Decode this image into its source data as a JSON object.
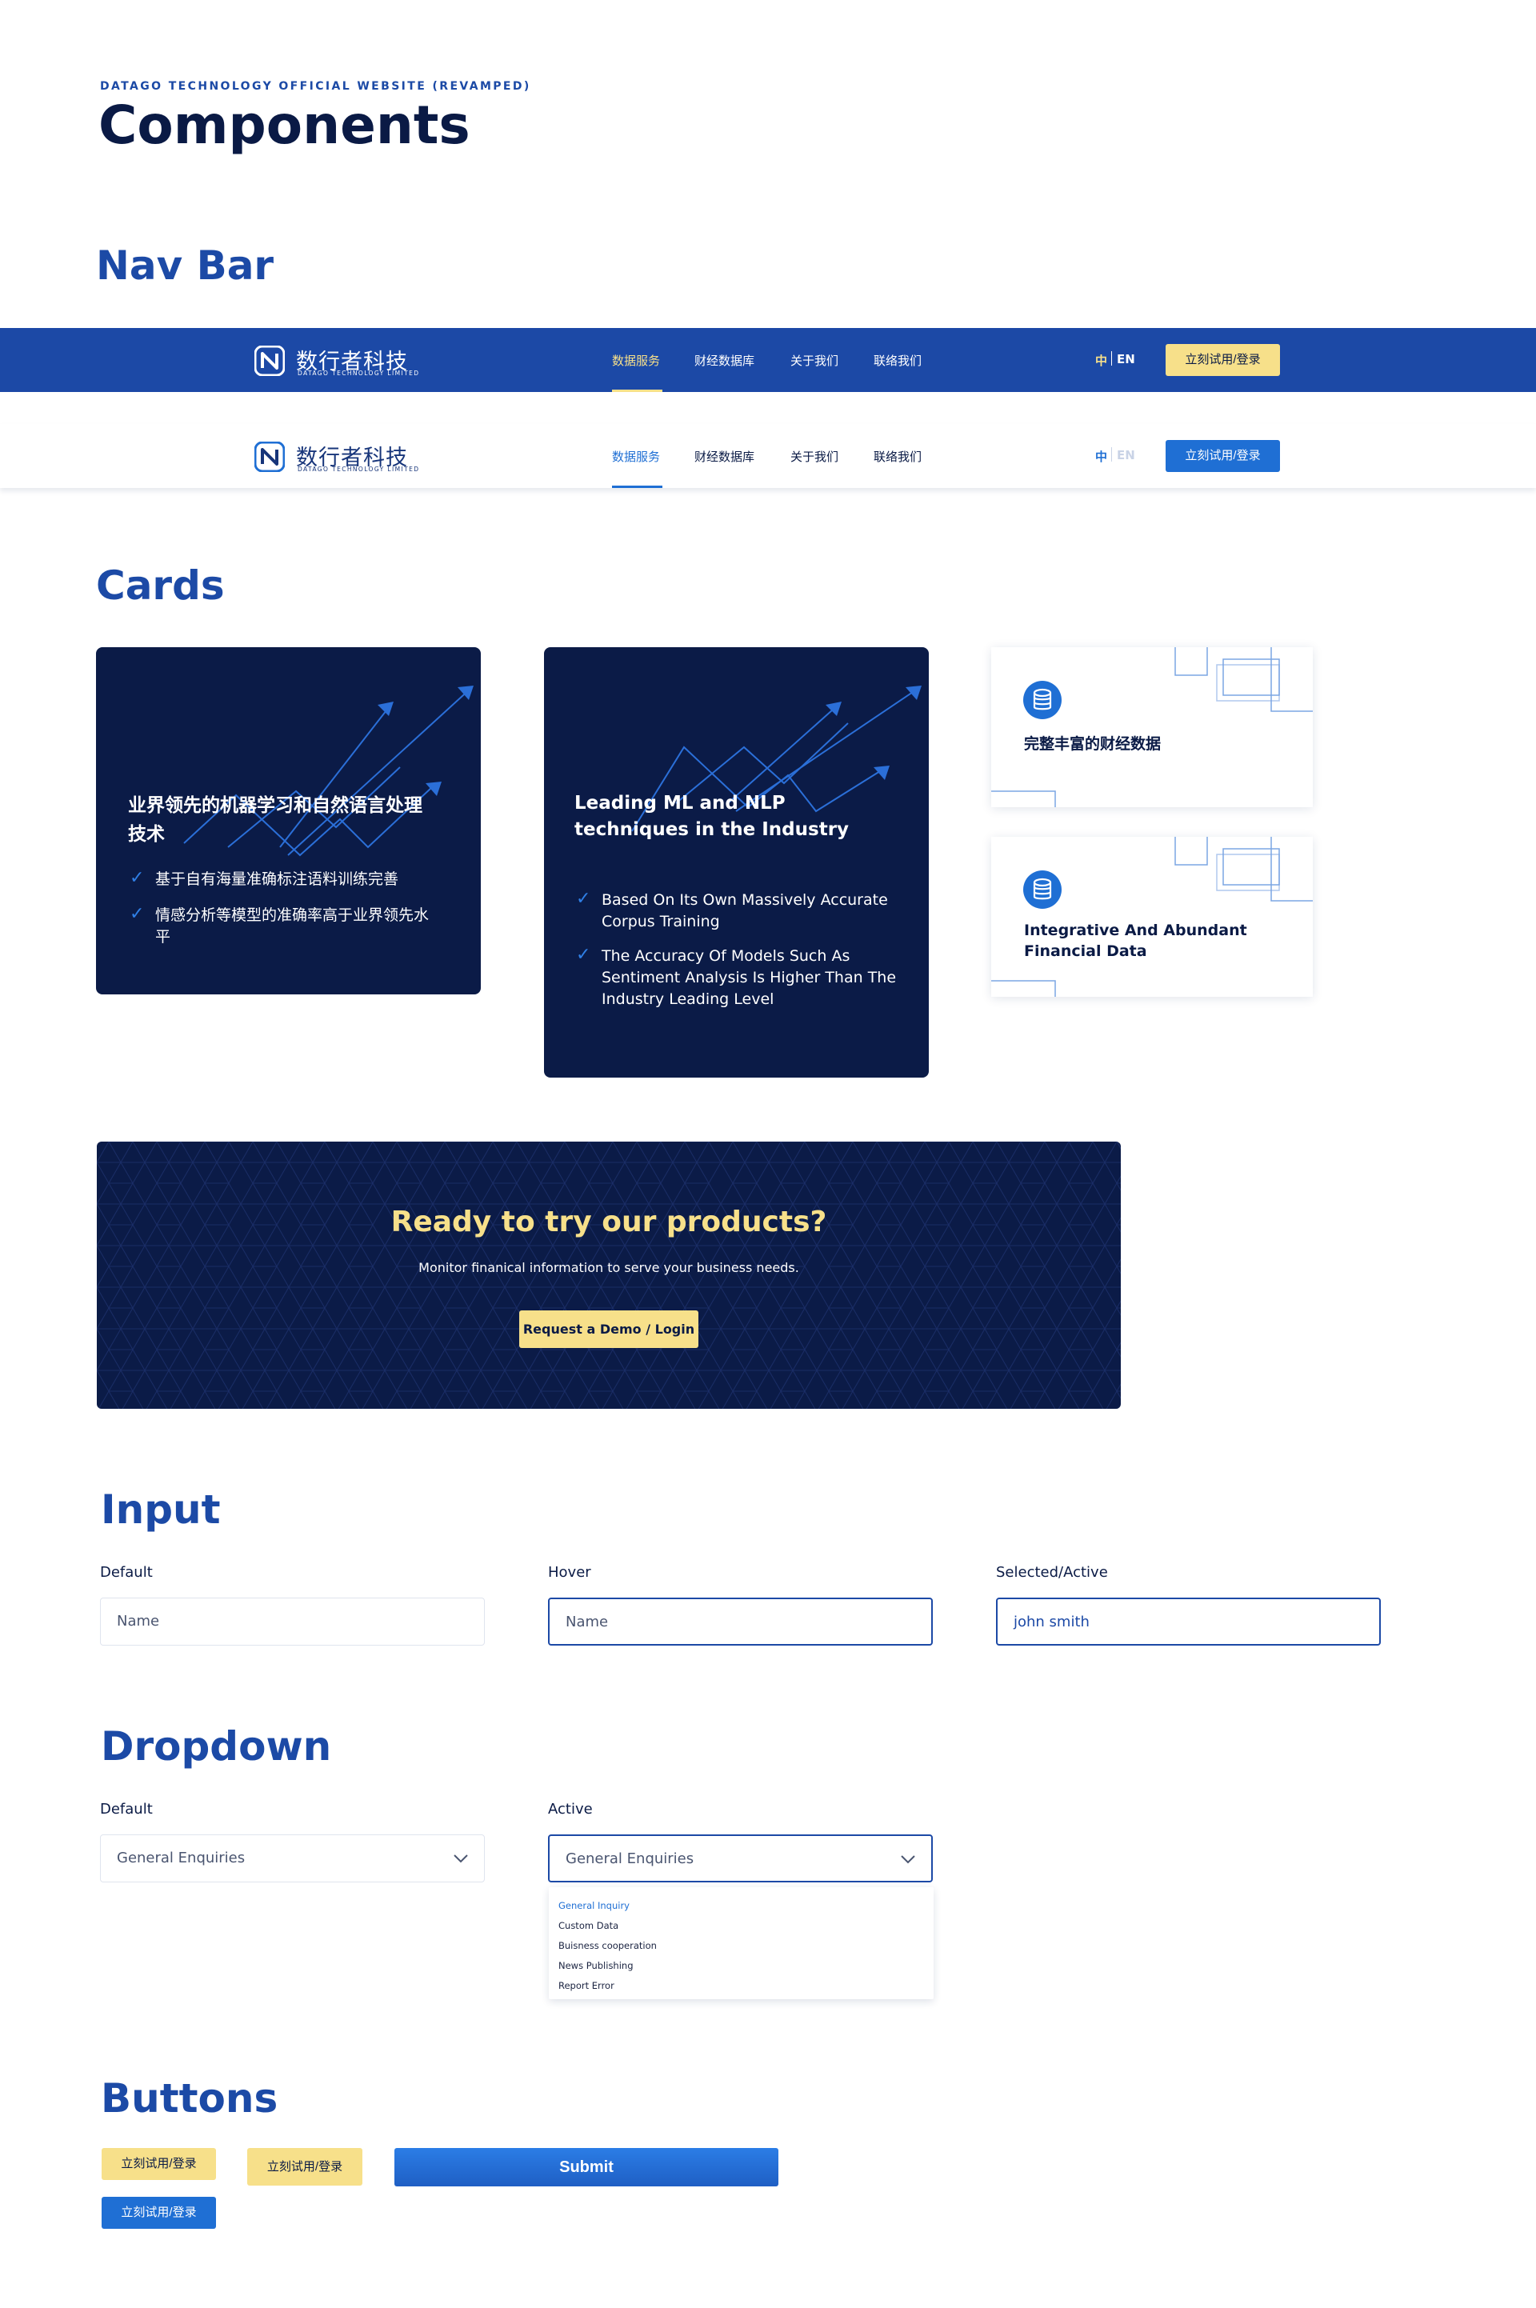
{
  "header": {
    "eyebrow": "DATAGO TECHNOLOGY OFFICIAL WEBSITE (REVAMPED)",
    "title": "Components"
  },
  "sections": {
    "nav_bar": "Nav Bar",
    "cards": "Cards",
    "input": "Input",
    "dropdown": "Dropdown",
    "buttons": "Buttons"
  },
  "logo": {
    "cn": "数行者科技",
    "en": "DATAGO TECHNOLOGY LIMITED"
  },
  "nav": {
    "items": [
      "数据服务",
      "财经数据库",
      "关于我们",
      "联络我们"
    ],
    "active_index": 0,
    "lang_cn": "中",
    "lang_en": "EN",
    "cta": "立刻试用/登录"
  },
  "cards": {
    "dark_cn": {
      "title_line1": "业界领先的机器学习和自然语言处理",
      "title_line2": "技术",
      "item1": "基于自有海量准确标注语料训练完善",
      "item2_line1": "情感分析等模型的准确率高于业界领先水",
      "item2_line2": "平"
    },
    "dark_en": {
      "title_line1": "Leading ML and NLP",
      "title_line2": "techniques in the Industry",
      "item1_line1": "Based On Its Own Massively Accurate",
      "item1_line2": "Corpus Training",
      "item2_line1": "The Accuracy Of Models Such As",
      "item2_line2": "Sentiment Analysis Is Higher Than The",
      "item2_line3": "Industry Leading Level"
    },
    "white_cn": {
      "title": "完整丰富的财经数据",
      "icon": "database-icon"
    },
    "white_en": {
      "title_line1": "Integrative And Abundant",
      "title_line2": "Financial Data",
      "icon": "database-icon"
    }
  },
  "banner": {
    "title": "Ready to try our products?",
    "subtitle": "Monitor finanical information to serve your business needs.",
    "button": "Request a Demo / Login"
  },
  "inputs": {
    "default_label": "Default",
    "hover_label": "Hover",
    "active_label": "Selected/Active",
    "placeholder": "Name",
    "active_value": "john smith"
  },
  "dropdowns": {
    "default_label": "Default",
    "active_label": "Active",
    "selected": "General Enquiries",
    "options": [
      "General Inquiry",
      "Custom Data",
      "Buisness cooperation",
      "News Publishing",
      "Report Error"
    ]
  },
  "buttons": {
    "cta": "立刻试用/登录",
    "submit": "Submit"
  },
  "colors": {
    "brand_blue": "#1c49a6",
    "accent_blue": "#1f6fd4",
    "navy": "#0b1b47",
    "yellow": "#f7e08a"
  }
}
